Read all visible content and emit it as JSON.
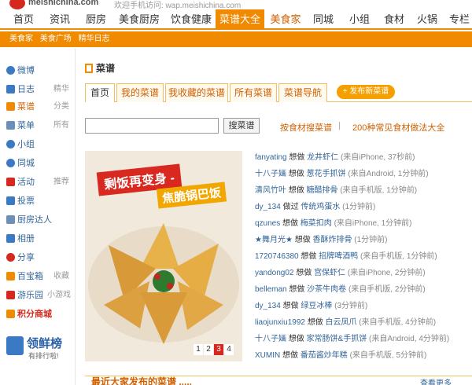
{
  "header": {
    "brand": "meishichina.com",
    "mobile_hint": "欢迎手机访问: wap.meishichina.com"
  },
  "nav": {
    "items": [
      "首页",
      "资讯",
      "厨房",
      "美食厨房",
      "饮食健康",
      "菜谱大全",
      "美食家",
      "同城",
      "小组",
      "食材",
      "火锅",
      "专栏"
    ]
  },
  "subnav": {
    "items": [
      "美食家",
      "美食广场",
      "精华日志"
    ]
  },
  "sidebar": {
    "items": [
      {
        "label": "微博",
        "extra": "",
        "icon": "weibo-icon",
        "color": "#3a79c4"
      },
      {
        "label": "日志",
        "extra": "精华",
        "icon": "blog-icon",
        "color": "#3a79c4"
      },
      {
        "label": "菜谱",
        "extra": "分类",
        "icon": "recipe-icon",
        "color": "#f08a00"
      },
      {
        "label": "菜单",
        "extra": "所有",
        "icon": "menu-icon",
        "color": "#6a8fb8"
      },
      {
        "label": "小组",
        "extra": "",
        "icon": "group-icon",
        "color": "#3a79c4"
      },
      {
        "label": "同城",
        "extra": "",
        "icon": "city-icon",
        "color": "#3a79c4"
      },
      {
        "label": "活动",
        "extra": "推荐",
        "icon": "event-icon",
        "color": "#d6281e"
      },
      {
        "label": "投票",
        "extra": "",
        "icon": "vote-icon",
        "color": "#3a79c4"
      },
      {
        "label": "厨房达人",
        "extra": "",
        "icon": "chef-icon",
        "color": "#6a8fb8"
      },
      {
        "label": "相册",
        "extra": "",
        "icon": "album-icon",
        "color": "#3a79c4"
      },
      {
        "label": "分享",
        "extra": "",
        "icon": "share-icon",
        "color": "#d6281e"
      },
      {
        "label": "百宝箱",
        "extra": "收藏",
        "icon": "treasure-icon",
        "color": "#f08a00"
      },
      {
        "label": "游乐园",
        "extra": "小游戏",
        "icon": "game-icon",
        "color": "#d6281e"
      },
      {
        "label": "积分商城",
        "extra": "",
        "icon": "shop-icon",
        "color": "#f08a00"
      }
    ],
    "rank_title": "领鲜榜",
    "rank_sub": "有排行啦!"
  },
  "main": {
    "title": "菜谱",
    "tabs": [
      "首页",
      "我的菜谱",
      "我收藏的菜谱",
      "所有菜谱",
      "菜谱导航"
    ],
    "publish_label": "+ 发布新菜谱",
    "search_placeholder": "",
    "search_button": "搜菜谱",
    "link_ingredient": "按食材搜菜谱",
    "link_sep": "|",
    "link_common": "200种常见食材做法大全",
    "photo_caption_1": "剩饭再变身 -",
    "photo_caption_2": "焦脆锅巴饭",
    "photo_pages": [
      "1",
      "2",
      "3",
      "4"
    ],
    "photo_active_page": "3",
    "bottom_title": "最近大家发布的菜谱 .....",
    "bottom_more": "查看更多"
  },
  "feed": [
    {
      "user": "fanyating",
      "verb": "想做",
      "recipe": "龙井虾仁",
      "src": "(来自iPhone, 37秒前)"
    },
    {
      "user": "十八子婳",
      "verb": "想做",
      "recipe": "葱花手抓饼",
      "src": "(来自Android, 1分钟前)"
    },
    {
      "user": "清风竹叶",
      "verb": "想做",
      "recipe": "糖醋排骨",
      "src": "(来自手机版, 1分钟前)"
    },
    {
      "user": "dy_134",
      "verb": "做过",
      "recipe": "传统鸡蛋水",
      "src": "(1分钟前)"
    },
    {
      "user": "qzunes",
      "verb": "想做",
      "recipe": "梅菜扣肉",
      "src": "(来自iPhone, 1分钟前)"
    },
    {
      "user": "★舞月光★",
      "verb": "想做",
      "recipe": "香酥炸排骨",
      "src": "(1分钟前)"
    },
    {
      "user": "1720746380",
      "verb": "想做",
      "recipe": "招牌啤酒鸭",
      "src": "(来自手机版, 1分钟前)"
    },
    {
      "user": "yandong02",
      "verb": "想做",
      "recipe": "宫保虾仁",
      "src": "(来自iPhone, 2分钟前)"
    },
    {
      "user": "belleman",
      "verb": "想做",
      "recipe": "沙茶牛肉卷",
      "src": "(来自手机版, 2分钟前)"
    },
    {
      "user": "dy_134",
      "verb": "想做",
      "recipe": "绿豆冰棒",
      "src": "(3分钟前)"
    },
    {
      "user": "liaojunxiu1992",
      "verb": "想做",
      "recipe": "白云凤爪",
      "src": "(来自手机版, 4分钟前)"
    },
    {
      "user": "十八子婳",
      "verb": "想做",
      "recipe": "家常肠饼&手抓饼",
      "src": "(来自Android, 4分钟前)"
    },
    {
      "user": "XUMIN",
      "verb": "想做",
      "recipe": "番茄酱炒年糕",
      "src": "(来自手机版, 5分钟前)"
    }
  ]
}
